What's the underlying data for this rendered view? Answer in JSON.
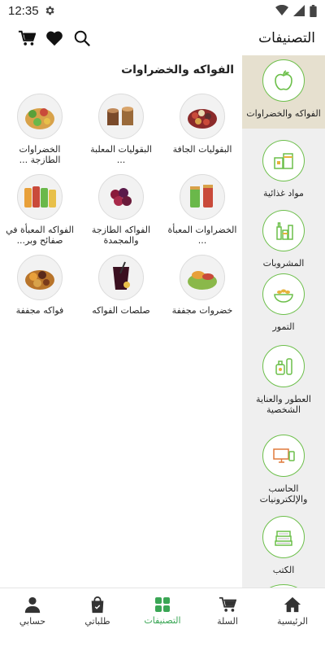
{
  "status": {
    "time": "12:35"
  },
  "header": {
    "title": "التصنيفات",
    "icons": [
      "cart-icon",
      "heart-icon",
      "search-icon"
    ]
  },
  "sidebar": {
    "items": [
      {
        "label": "الفواكه والخضراوات",
        "icon": "apple-icon",
        "active": true
      },
      {
        "label": "مواد غذائية",
        "icon": "grocery-icon",
        "active": false
      },
      {
        "label": "المشروبات",
        "icon": "bottles-icon",
        "active": false
      },
      {
        "label": "التمور",
        "icon": "dates-bowl-icon",
        "active": false
      },
      {
        "label": "العطور والعناية الشخصية",
        "icon": "perfume-icon",
        "active": false
      },
      {
        "label": "الحاسب والإلكترونيات",
        "icon": "computer-icon",
        "active": false
      },
      {
        "label": "الكتب",
        "icon": "books-icon",
        "active": false
      }
    ]
  },
  "main": {
    "section_title": "الفواكه والخضراوات",
    "products": [
      {
        "label": "البقوليات الجافة"
      },
      {
        "label": "البقوليات المعلبة ..."
      },
      {
        "label": "الخضراوات الطازجة ..."
      },
      {
        "label": "الخضراوات المعبأة ..."
      },
      {
        "label": "الفواكه الطازجة والمجمدة"
      },
      {
        "label": "الفواكه المعبأة في صفائح وبر..."
      },
      {
        "label": "خضروات مجففة"
      },
      {
        "label": "صلصات الفواكه"
      },
      {
        "label": "فواكه مجففة"
      }
    ]
  },
  "bottom_nav": {
    "items": [
      {
        "label": "حسابي",
        "icon": "person-icon"
      },
      {
        "label": "طلباتي",
        "icon": "shopping-bag-icon"
      },
      {
        "label": "التصنيفات",
        "icon": "grid-icon",
        "active": true
      },
      {
        "label": "السلة",
        "icon": "cart-icon"
      },
      {
        "label": "الرئيسية",
        "icon": "home-icon"
      }
    ]
  },
  "colors": {
    "accent": "#3aa655",
    "sidebar_bg": "#efefef",
    "sidebar_active_bg": "#e6e0cf",
    "icon_green": "#6cbf4a"
  }
}
